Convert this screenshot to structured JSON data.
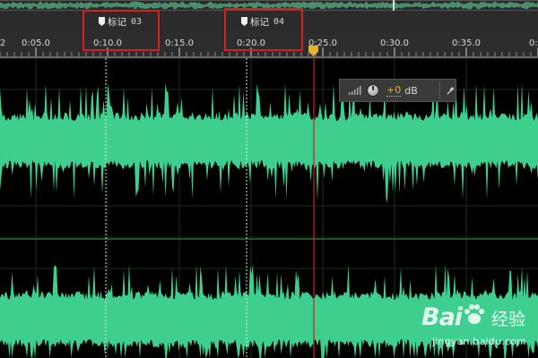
{
  "markers": [
    {
      "label": "标记",
      "number": "03"
    },
    {
      "label": "标记",
      "number": "04"
    }
  ],
  "ruler": {
    "left_edge_label": "2",
    "right_edge_label": "0:4",
    "ticks": [
      "0:05.0",
      "0:10.0",
      "0:15.0",
      "0:20.0",
      "0:25.0",
      "0:30.0",
      "0:35.0"
    ]
  },
  "level_panel": {
    "value": "+0",
    "unit": "dB"
  },
  "watermark": {
    "brand": "Bai",
    "suffix": "经验",
    "url": "jingyan.baidu.com"
  },
  "colors": {
    "waveform": "#3ecf8e",
    "playhead": "#e4b329",
    "marker_highlight": "#d91f22",
    "background": "#000000"
  }
}
